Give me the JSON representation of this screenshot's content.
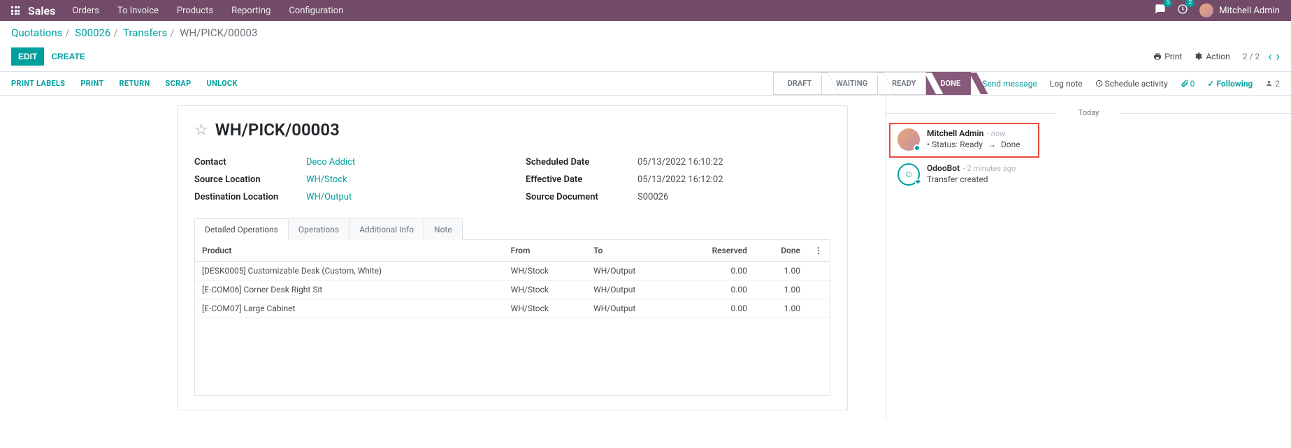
{
  "topnav": {
    "app": "Sales",
    "menu": [
      "Orders",
      "To Invoice",
      "Products",
      "Reporting",
      "Configuration"
    ],
    "chat_badge": "5",
    "clock_badge": "2",
    "user": "Mitchell Admin"
  },
  "breadcrumb": {
    "items": [
      "Quotations",
      "S00026",
      "Transfers"
    ],
    "current": "WH/PICK/00003"
  },
  "buttons": {
    "edit": "EDIT",
    "create": "CREATE",
    "print": "Print",
    "action": "Action"
  },
  "pager": {
    "text": "2 / 2"
  },
  "statusbar": {
    "left": [
      "PRINT LABELS",
      "PRINT",
      "RETURN",
      "SCRAP",
      "UNLOCK"
    ],
    "steps": [
      "DRAFT",
      "WAITING",
      "READY",
      "DONE"
    ],
    "active_step": "DONE",
    "send": "Send message",
    "lognote": "Log note",
    "schedule": "Schedule activity",
    "attachments": "0",
    "following": "Following",
    "followers": "2"
  },
  "record": {
    "title": "WH/PICK/00003",
    "fields_left": [
      {
        "label": "Contact",
        "value": "Deco Addict",
        "link": true
      },
      {
        "label": "Source Location",
        "value": "WH/Stock",
        "link": true
      },
      {
        "label": "Destination Location",
        "value": "WH/Output",
        "link": true
      }
    ],
    "fields_right": [
      {
        "label": "Scheduled Date",
        "value": "05/13/2022 16:10:22"
      },
      {
        "label": "Effective Date",
        "value": "05/13/2022 16:12:02"
      },
      {
        "label": "Source Document",
        "value": "S00026"
      }
    ]
  },
  "tabs": [
    "Detailed Operations",
    "Operations",
    "Additional Info",
    "Note"
  ],
  "active_tab": 0,
  "table": {
    "columns": [
      "Product",
      "From",
      "To",
      "Reserved",
      "Done"
    ],
    "rows": [
      {
        "product": "[DESK0005] Customizable Desk (Custom, White)",
        "from": "WH/Stock",
        "to": "WH/Output",
        "reserved": "0.00",
        "done": "1.00"
      },
      {
        "product": "[E-COM06] Corner Desk Right Sit",
        "from": "WH/Stock",
        "to": "WH/Output",
        "reserved": "0.00",
        "done": "1.00"
      },
      {
        "product": "[E-COM07] Large Cabinet",
        "from": "WH/Stock",
        "to": "WH/Output",
        "reserved": "0.00",
        "done": "1.00"
      }
    ]
  },
  "chatter": {
    "today": "Today",
    "messages": [
      {
        "author": "Mitchell Admin",
        "time": "- now",
        "content_prefix": "Status:",
        "from": "Ready",
        "to": "Done",
        "type": "user",
        "highlighted": true
      },
      {
        "author": "OdooBot",
        "time": "- 2 minutes ago",
        "content": "Transfer created",
        "type": "bot"
      }
    ]
  }
}
